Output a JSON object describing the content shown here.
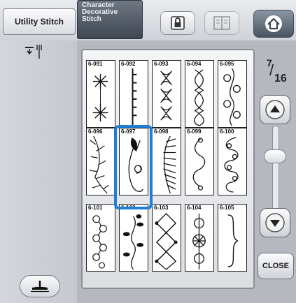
{
  "tabs": {
    "utility_label": "Utility Stitch",
    "character_lines": [
      "Character",
      "Decorative",
      "Stitch"
    ]
  },
  "toolbar": {
    "lock_icon": "lock-icon",
    "book_icon": "book-icon",
    "home_icon": "home-icon"
  },
  "page": {
    "current": "7",
    "total": "16"
  },
  "close_label": "CLOSE",
  "accent_color": "#1f7fd6",
  "stitches": [
    {
      "code": "6-091",
      "pattern": "snowflake"
    },
    {
      "code": "6-092",
      "pattern": "dotted-line"
    },
    {
      "code": "6-093",
      "pattern": "cross-chain"
    },
    {
      "code": "6-094",
      "pattern": "braid"
    },
    {
      "code": "6-095",
      "pattern": "clover-vine"
    },
    {
      "code": "6-096",
      "pattern": "branch"
    },
    {
      "code": "6-097",
      "pattern": "leaf-curl"
    },
    {
      "code": "6-098",
      "pattern": "fern"
    },
    {
      "code": "6-099",
      "pattern": "zigzag-curl"
    },
    {
      "code": "6-100",
      "pattern": "scroll"
    },
    {
      "code": "6-101",
      "pattern": "spiral-chain"
    },
    {
      "code": "6-102",
      "pattern": "leaf-vine"
    },
    {
      "code": "6-103",
      "pattern": "diamond-knot"
    },
    {
      "code": "6-104",
      "pattern": "loop-knot"
    },
    {
      "code": "6-105",
      "pattern": "brace"
    }
  ],
  "selected_code": "6-097"
}
